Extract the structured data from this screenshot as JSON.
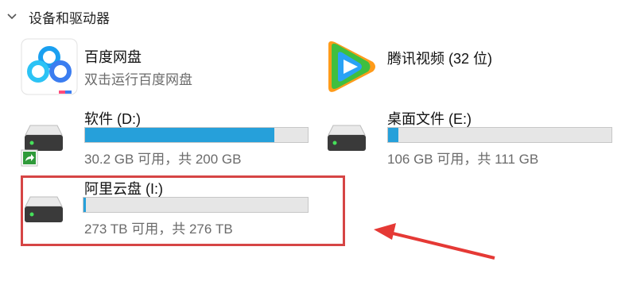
{
  "section": {
    "title": "设备和驱动器"
  },
  "apps": [
    {
      "name": "百度网盘",
      "subtitle": "双击运行百度网盘",
      "icon": "baidu-netdisk-icon"
    },
    {
      "name": "腾讯视频 (32 位)",
      "icon": "tencent-video-icon"
    }
  ],
  "drives": [
    {
      "name": "软件 (D:)",
      "free_text": "30.2 GB 可用，共 200 GB",
      "used_fraction": 0.849,
      "icon": "hard-drive-icon",
      "shortcut_badge": "shortcut-arrow-icon"
    },
    {
      "name": "桌面文件 (E:)",
      "free_text": "106 GB 可用，共 111 GB",
      "used_fraction": 0.045,
      "icon": "hard-drive-icon"
    },
    {
      "name": "阿里云盘 (I:)",
      "free_text": "273 TB 可用，共 276 TB",
      "used_fraction": 0.011,
      "icon": "hard-drive-icon"
    }
  ],
  "colors": {
    "bar_fill": "#26a0da",
    "bar_track": "#e6e6e6",
    "highlight": "#d64545",
    "arrow": "#e53935"
  }
}
